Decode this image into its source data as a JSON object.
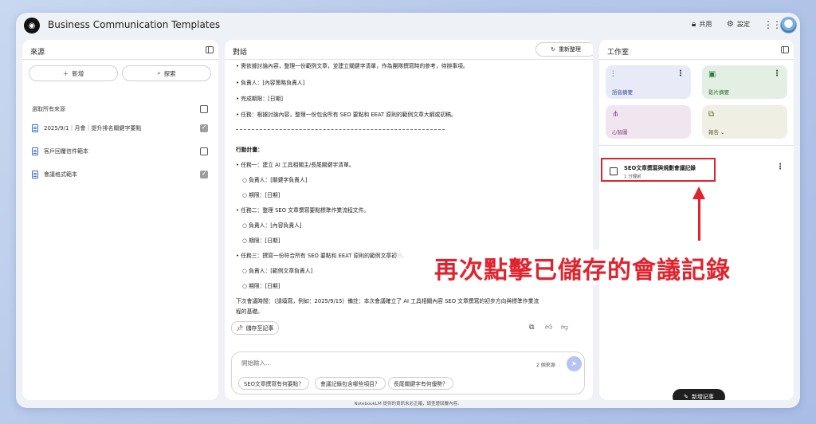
{
  "app": {
    "title": "Business Communication Templates",
    "logo": "notebooklm-logo"
  },
  "topbar": {
    "share_label": "共用",
    "settings_label": "設定",
    "apps_icon": "apps-grid-icon"
  },
  "sources": {
    "header": "來源",
    "add_label": "新增",
    "explore_label": "探索",
    "select_all_label": "選取所有來源",
    "items": [
      {
        "label": "2025/9/1｜月會｜提升排名關鍵字要點",
        "checked": true
      },
      {
        "label": "客戶回覆信件範本",
        "checked": false
      },
      {
        "label": "會議格式範本",
        "checked": true
      }
    ]
  },
  "chat": {
    "header": "對話",
    "reorganize_label": "重新整理",
    "lines": [
      "• 需依據討論內容，整理一份範例文章，並建立關鍵字清單，作為團隊撰寫時的參考，待辦事項。",
      "• 負責人：[內容策略負責人]",
      "• 完成期限：[日期]",
      "• 任務：根據討論內容，整理一份包含所有 SEO 要點和 EEAT 原則的範例文章大綱或初稿。",
      "行動計畫：",
      "• 任務一：建立 AI 工具相關主/長尾關鍵字清單。",
      "○ 負責人：[關鍵字負責人]",
      "○ 期限：[日期]",
      "• 任務二：整理 SEO 文章撰寫要點標準作業流程文件。",
      "○ 負責人：[內容負責人]",
      "○ 期限：[日期]",
      "• 任務三：撰寫一份符合所有 SEO 要點和 EEAT 原則的範例文章初稿。",
      "○ 負責人：[範例文章負責人]",
      "○ 期限：[日期]",
      "下次會議時間：（請填寫，例如：2025/9/15）備註：本次會議確立了 AI 工具相關內容 SEO 文章撰寫的初步方向與標準作業流",
      "程的基礎。"
    ],
    "save_note_label": "儲存至記事",
    "input_placeholder": "開始輸入...",
    "source_count": "2 個來源",
    "suggestions": [
      "SEO文章撰寫有何要點？",
      "會議記錄包含哪些項目？",
      "長尾關鍵字有何優勢？"
    ]
  },
  "studio": {
    "header": "工作室",
    "tiles": [
      {
        "label": "語音摘要",
        "icon": "audio-wave-icon",
        "bg": "#e8ebf7"
      },
      {
        "label": "影片摘要",
        "icon": "video-icon",
        "bg": "#e4efe4"
      },
      {
        "label": "心智圖",
        "icon": "mindmap-icon",
        "bg": "#f0e6f0"
      },
      {
        "label": "報告",
        "icon": "report-icon",
        "bg": "#efefe4"
      }
    ],
    "note": {
      "title": "SEO文章撰寫與規劃會議記錄",
      "time": "1 分鐘前"
    },
    "add_note_label": "新增記事"
  },
  "footer": {
    "disclaimer": "NotebookLM 提供的資訊未必正確，請查證回覆內容。"
  },
  "annotation": {
    "text": "再次點擊已儲存的會議記錄",
    "color": "#e0242f"
  }
}
